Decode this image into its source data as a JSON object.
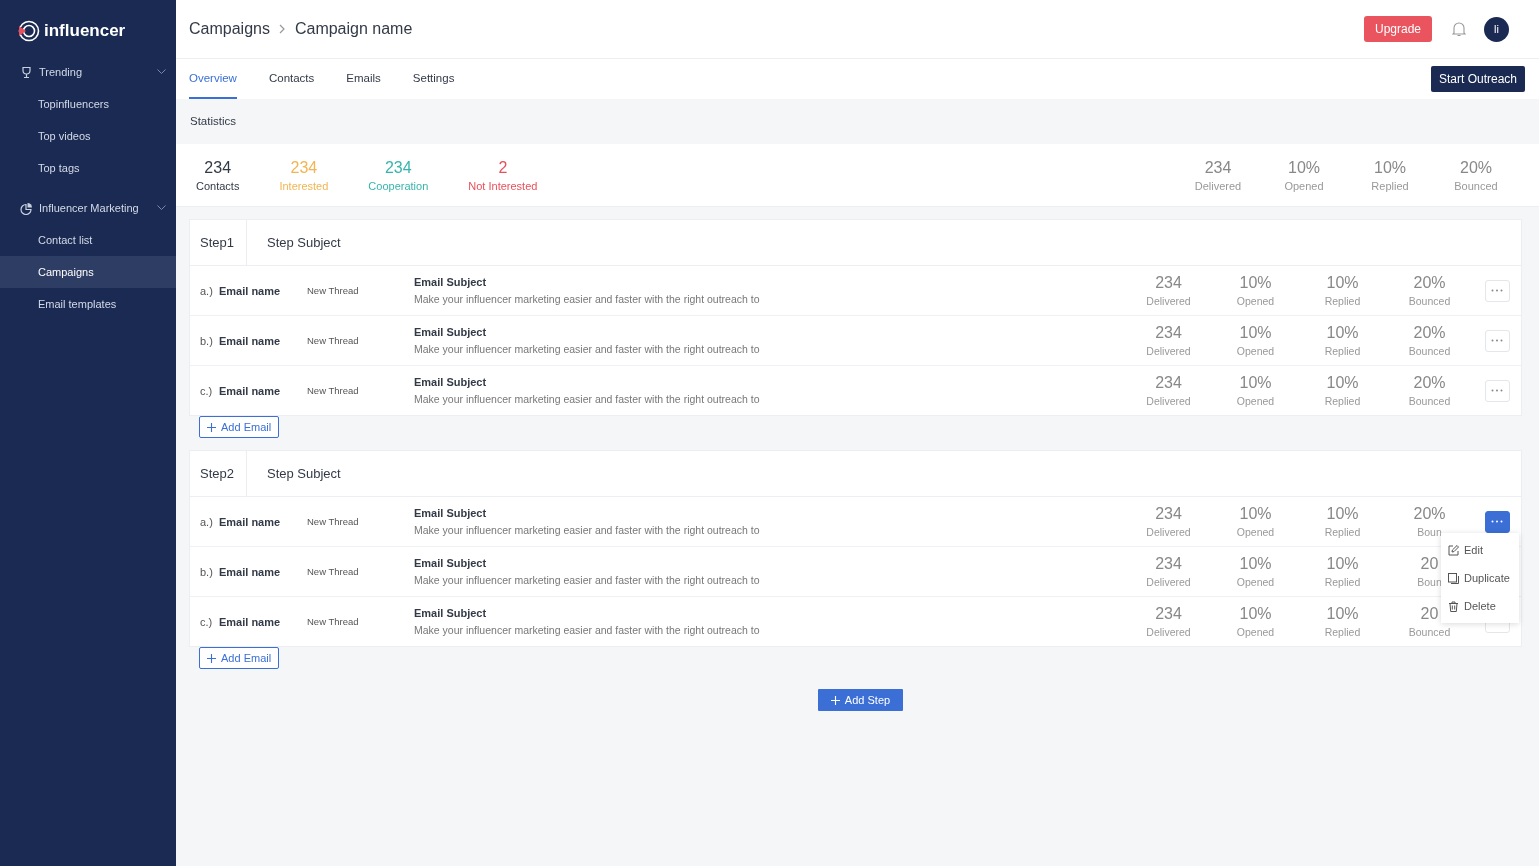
{
  "sidebar": {
    "logo": "influencer",
    "items": [
      {
        "label": "Trending",
        "expanded": true,
        "children": [
          {
            "label": "Topinfluencers",
            "selected": false
          },
          {
            "label": "Top videos",
            "selected": false
          },
          {
            "label": "Top tags",
            "selected": false
          }
        ]
      },
      {
        "label": "Influencer Marketing",
        "expanded": true,
        "children": [
          {
            "label": "Contact list",
            "selected": false
          },
          {
            "label": "Campaigns",
            "selected": true
          },
          {
            "label": "Email templates",
            "selected": false
          }
        ]
      }
    ]
  },
  "breadcrumb": [
    "Campaigns",
    "Campaign name"
  ],
  "header": {
    "upgrade": "Upgrade",
    "avatar": "li"
  },
  "tabs": [
    {
      "label": "Overview",
      "selected": true
    },
    {
      "label": "Contacts",
      "selected": false
    },
    {
      "label": "Emails",
      "selected": false
    },
    {
      "label": "Settings",
      "selected": false
    }
  ],
  "start_button": "Start Outreach",
  "statistics": {
    "title": "Statistics",
    "left": [
      {
        "value": "234",
        "label": "Contacts",
        "color": "#333a47"
      },
      {
        "value": "234",
        "label": "Interested",
        "color": "#f2b551"
      },
      {
        "value": "234",
        "label": "Cooperation",
        "color": "#37b5ac"
      },
      {
        "value": "2",
        "label": "Not Interested",
        "color": "#e8505b"
      }
    ],
    "right": [
      {
        "value": "234",
        "label": "Delivered"
      },
      {
        "value": "10%",
        "label": "Opened"
      },
      {
        "value": "10%",
        "label": "Replied"
      },
      {
        "value": "20%",
        "label": "Bounced"
      }
    ]
  },
  "steps": [
    {
      "step": "Step1",
      "subject": "Step Subject",
      "add_email": "Add Email",
      "emails": [
        {
          "letter": "a.)",
          "name": "Email name",
          "thread": "New Thread",
          "subject": "Email Subject",
          "body": "Make your influencer marketing easier and faster with the right outreach to",
          "menu_open": false,
          "stats": [
            {
              "value": "234",
              "label": "Delivered"
            },
            {
              "value": "10%",
              "label": "Opened"
            },
            {
              "value": "10%",
              "label": "Replied"
            },
            {
              "value": "20%",
              "label": "Bounced"
            }
          ]
        },
        {
          "letter": "b.)",
          "name": "Email name",
          "thread": "New Thread",
          "subject": "Email Subject",
          "body": "Make your influencer marketing easier and faster with the right outreach to",
          "menu_open": false,
          "stats": [
            {
              "value": "234",
              "label": "Delivered"
            },
            {
              "value": "10%",
              "label": "Opened"
            },
            {
              "value": "10%",
              "label": "Replied"
            },
            {
              "value": "20%",
              "label": "Bounced"
            }
          ]
        },
        {
          "letter": "c.)",
          "name": "Email name",
          "thread": "New Thread",
          "subject": "Email Subject",
          "body": "Make your influencer marketing easier and faster with the right outreach to",
          "menu_open": false,
          "stats": [
            {
              "value": "234",
              "label": "Delivered"
            },
            {
              "value": "10%",
              "label": "Opened"
            },
            {
              "value": "10%",
              "label": "Replied"
            },
            {
              "value": "20%",
              "label": "Bounced"
            }
          ]
        }
      ]
    },
    {
      "step": "Step2",
      "subject": "Step Subject",
      "add_email": "Add Email",
      "emails": [
        {
          "letter": "a.)",
          "name": "Email name",
          "thread": "New Thread",
          "subject": "Email Subject",
          "body": "Make your influencer marketing easier and faster with the right outreach to",
          "menu_open": true,
          "menu": [
            {
              "label": "Edit"
            },
            {
              "label": "Duplicate"
            },
            {
              "label": "Delete"
            }
          ],
          "stats": [
            {
              "value": "234",
              "label": "Delivered"
            },
            {
              "value": "10%",
              "label": "Opened"
            },
            {
              "value": "10%",
              "label": "Replied"
            },
            {
              "value": "20%",
              "label": "Boun"
            }
          ]
        },
        {
          "letter": "b.)",
          "name": "Email name",
          "thread": "New Thread",
          "subject": "Email Subject",
          "body": "Make your influencer marketing easier and faster with the right outreach to",
          "stats": [
            {
              "value": "234",
              "label": "Delivered"
            },
            {
              "value": "10%",
              "label": "Opened"
            },
            {
              "value": "10%",
              "label": "Replied"
            },
            {
              "value": "20",
              "label": "Boun"
            }
          ]
        },
        {
          "letter": "c.)",
          "name": "Email name",
          "thread": "New Thread",
          "subject": "Email Subject",
          "body": "Make your influencer marketing easier and faster with the right outreach to",
          "menu_open": false,
          "stats": [
            {
              "value": "234",
              "label": "Delivered"
            },
            {
              "value": "10%",
              "label": "Opened"
            },
            {
              "value": "10%",
              "label": "Replied"
            },
            {
              "value": "20",
              "label": "Bounced"
            }
          ]
        }
      ]
    }
  ],
  "add_step": "Add Step"
}
